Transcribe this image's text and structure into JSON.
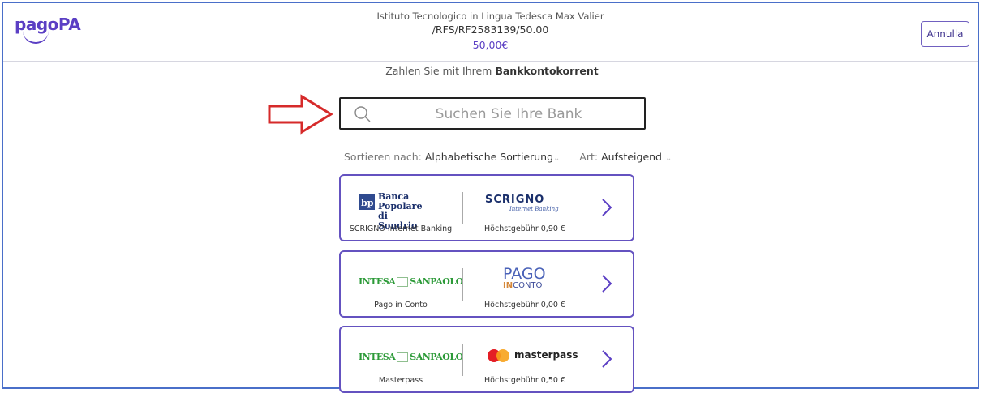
{
  "header": {
    "logo_text": "pagoPA",
    "creditor": "Istituto Tecnologico in Lingua Tedesca Max Valier",
    "reference": "/RFS/RF2583139/50.00",
    "amount": "50,00€",
    "cancel_label": "Annulla"
  },
  "subtitle": {
    "prefix": "Zahlen Sie mit Ihrem",
    "bold": "Bankkontokorrent"
  },
  "search": {
    "placeholder": "Suchen Sie Ihre Bank",
    "value": ""
  },
  "sort": {
    "label": "Sortieren nach:",
    "value": "Alphabetische Sortierung",
    "type_label": "Art:",
    "type_value": "Aufsteigend"
  },
  "banks": [
    {
      "logo_line1": "Banca Popolare",
      "logo_line2": "di Sondrio",
      "service_logo_text": "SCRIGNO",
      "service_logo_sub": "Internet Banking",
      "name": "SCRIGNO Internet Banking",
      "fee": "Höchstgebühr 0,90 €"
    },
    {
      "logo_left": "INTESA",
      "logo_right": "SANPAOLO",
      "service_logo_top": "PAGO",
      "service_logo_bottom_a": "IN",
      "service_logo_bottom_b": "CONTO",
      "name": "Pago in Conto",
      "fee": "Höchstgebühr 0,00 €"
    },
    {
      "logo_left": "INTESA",
      "logo_right": "SANPAOLO",
      "service_logo_text": "masterpass",
      "name": "Masterpass",
      "fee": "Höchstgebühr 0,50 €"
    }
  ],
  "colors": {
    "accent": "#5b3fc4",
    "card_border": "#6452c0",
    "arrow": "#d62a2a"
  }
}
